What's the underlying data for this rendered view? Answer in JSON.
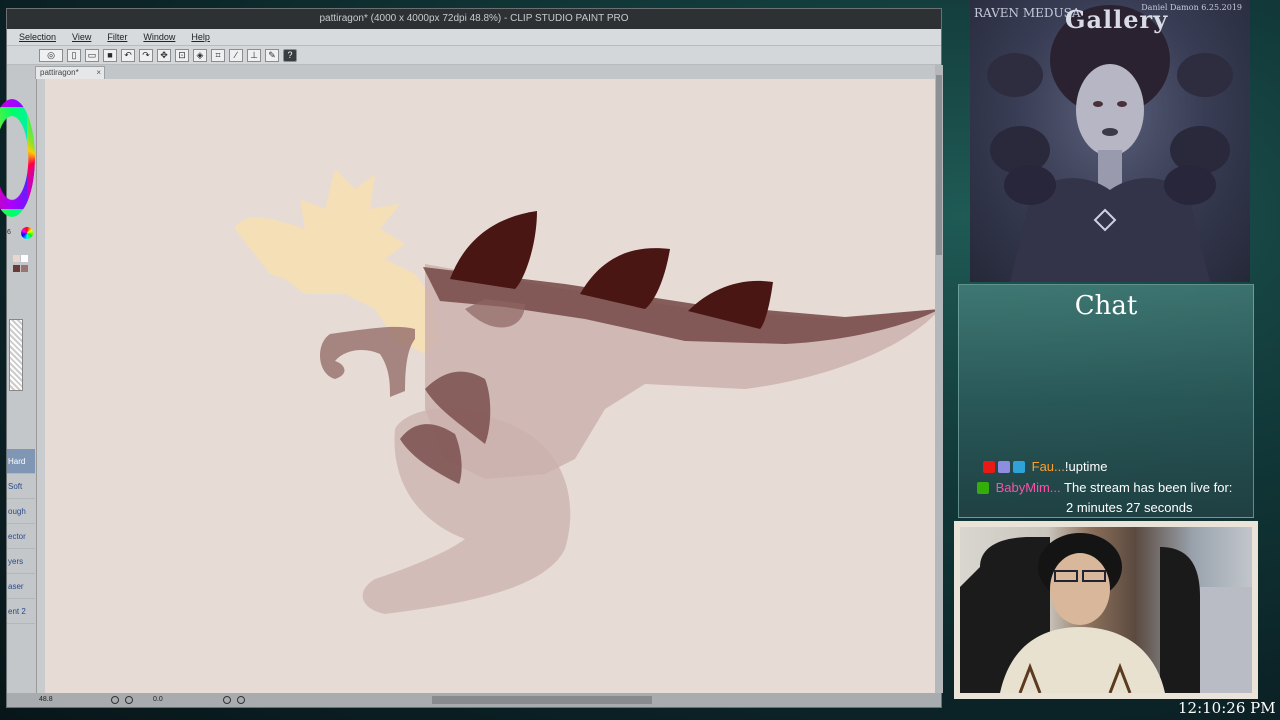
{
  "window": {
    "title": "pattiragon* (4000 x 4000px 72dpi 48.8%) - CLIP STUDIO PAINT PRO"
  },
  "menu": {
    "items": [
      "Selection",
      "View",
      "Filter",
      "Window",
      "Help"
    ]
  },
  "toolbar": {
    "help_label": "?"
  },
  "tab": {
    "label": "pattiragon*",
    "close": "×"
  },
  "left_tools": [
    "Hard",
    "Soft",
    "ough",
    "ector",
    "yers",
    "aser",
    "ent 2"
  ],
  "left_indicator": "6",
  "status": {
    "zoom": "48.8",
    "angle": "0.0"
  },
  "gallery": {
    "title": "Gallery",
    "artist": "RAVEN MEDUSA",
    "signature": "Daniel Damon 6.25.2019"
  },
  "chat": {
    "title": "Chat",
    "messages": [
      {
        "user": "Fau...",
        "text": "!uptime"
      },
      {
        "user": "BabyMim...",
        "text": "The stream has been live for:",
        "cont": "2 minutes 27 seconds"
      }
    ]
  },
  "clock": "12:10:26 PM",
  "colors": {
    "canvas_bg": "#e7dbd6",
    "accent_dark": "#4a1614",
    "body_mid": "#7a4f4c",
    "head_yellow": "#f6dfb4"
  }
}
